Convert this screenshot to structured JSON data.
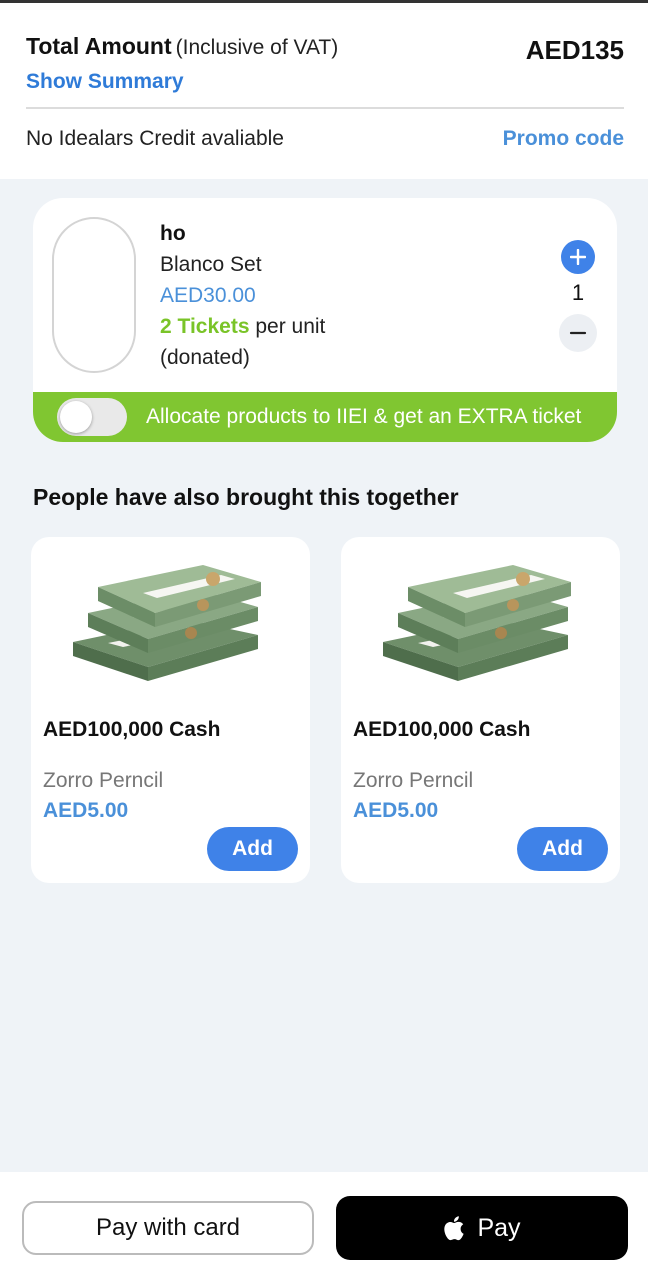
{
  "summary": {
    "total_label": "Total Amount",
    "total_note": "(Inclusive of VAT)",
    "total_amount": "AED135",
    "show_summary": "Show Summary",
    "credit_text": "No Idealars Credit avaliable",
    "promo_label": "Promo code"
  },
  "cart_item": {
    "name": "ho",
    "variant": "Blanco Set",
    "price": "AED30.00",
    "tickets": "2 Tickets",
    "tickets_suffix": " per unit",
    "note": "(donated)",
    "quantity": "1",
    "allocate_text": "Allocate products to IIEI & get an EXTRA ticket",
    "allocate_enabled": false
  },
  "related": {
    "title": "People have also brought this together",
    "products": [
      {
        "title": "AED100,000 Cash",
        "subtitle": "Zorro Perncil",
        "price": "AED5.00",
        "add_label": "Add",
        "image": "cash-bundle-image"
      },
      {
        "title": "AED100,000 Cash",
        "subtitle": "Zorro Perncil",
        "price": "AED5.00",
        "add_label": "Add",
        "image": "cash-bundle-image"
      }
    ]
  },
  "payment": {
    "card_label": "Pay with card",
    "apple_pay_label": "Pay"
  },
  "colors": {
    "accent_blue": "#3f82e8",
    "link_blue": "#2f7bd8",
    "ticket_green": "#80c631",
    "background": "#eff3f7"
  }
}
